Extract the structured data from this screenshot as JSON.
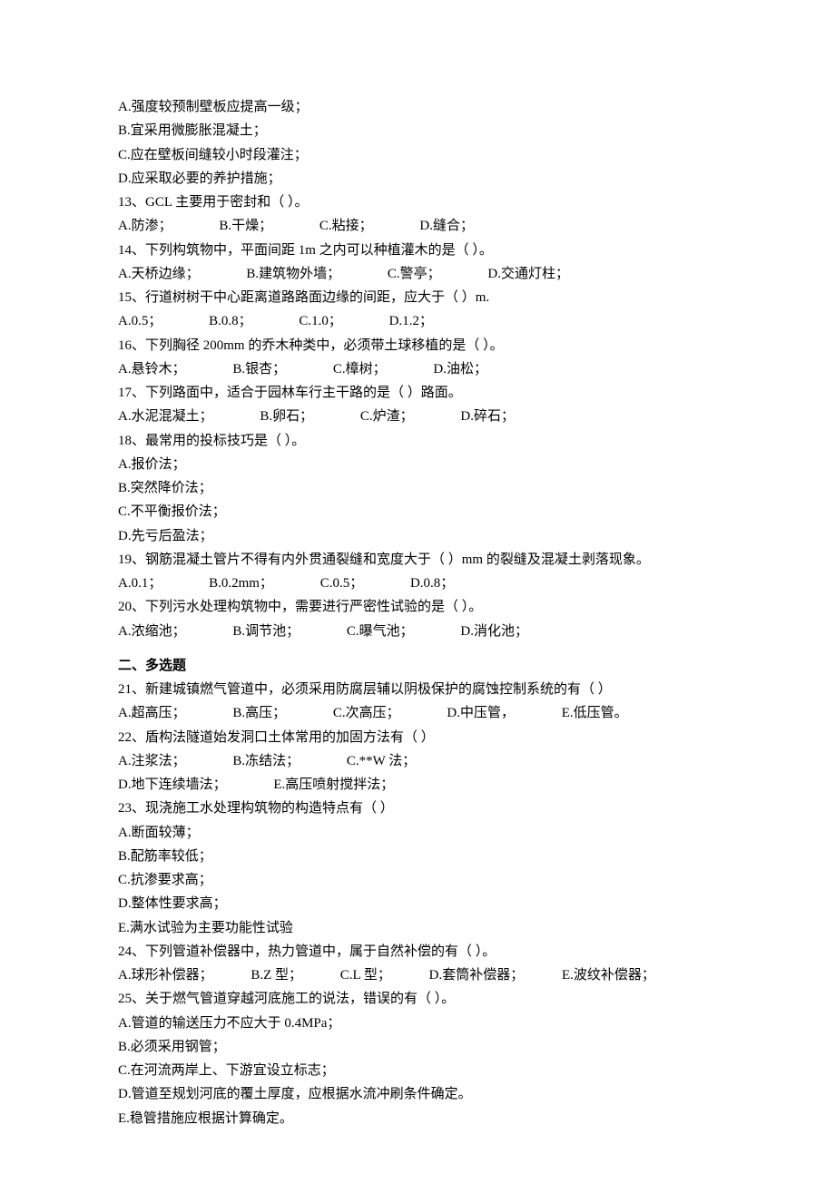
{
  "section1": {
    "orphan_options": [
      "A.强度较预制壁板应提高一级；",
      "B.宜采用微膨胀混凝土；",
      "C.应在壁板间缝较小时段灌注；",
      "D.应采取必要的养护措施；"
    ],
    "questions": [
      {
        "stem": "13、GCL 主要用于密封和（ ）。",
        "opts": [
          "A.防渗；",
          "B.干燥；",
          "C.粘接；",
          "D.缝合；"
        ]
      },
      {
        "stem": "14、下列构筑物中，平面间距 1m 之内可以种植灌木的是（ ）。",
        "opts": [
          "A.天桥边缘；",
          "B.建筑物外墙；",
          "C.警亭；",
          "D.交通灯柱；"
        ]
      },
      {
        "stem": "15、行道树树干中心距离道路路面边缘的间距，应大于（ ）m.",
        "opts": [
          "A.0.5；",
          "B.0.8；",
          "C.1.0；",
          "D.1.2；"
        ]
      },
      {
        "stem": "16、下列胸径 200mm 的乔木种类中，必须带土球移植的是（ ）。",
        "opts": [
          "A.悬铃木；",
          "B.银杏；",
          "C.樟树；",
          "D.油松；"
        ]
      },
      {
        "stem": "17、下列路面中，适合于园林车行主干路的是（ ）路面。",
        "opts": [
          "A.水泥混凝土；",
          "B.卵石；",
          "C.炉渣；",
          "D.碎石；"
        ]
      },
      {
        "stem": "18、最常用的投标技巧是（ ）。",
        "opts_block": [
          "A.报价法；",
          "B.突然降价法；",
          "C.不平衡报价法；",
          "D.先亏后盈法；"
        ]
      },
      {
        "stem": "19、钢筋混凝土管片不得有内外贯通裂缝和宽度大于（ ）mm 的裂缝及混凝土剥落现象。",
        "opts": [
          "A.0.1；",
          "B.0.2mm；",
          "C.0.5；",
          "D.0.8；"
        ]
      },
      {
        "stem": "20、下列污水处理构筑物中，需要进行严密性试验的是（ ）。",
        "opts": [
          "A.浓缩池；",
          "B.调节池；",
          "C.曝气池；",
          "D.消化池；"
        ]
      }
    ]
  },
  "section2": {
    "heading": "二、多选题",
    "questions": [
      {
        "stem": "21、新建城镇燃气管道中，必须采用防腐层辅以阴极保护的腐蚀控制系统的有（ ）",
        "opts": [
          "A.超高压；",
          "B.高压；",
          "C.次高压；",
          "D.中压管，",
          "E.低压管。"
        ]
      },
      {
        "stem": "22、盾构法隧道始发洞口土体常用的加固方法有（ ）",
        "opts_line1": [
          "A.注浆法；",
          "B.冻结法；",
          "C.**W 法；"
        ],
        "opts_line2": [
          "D.地下连续墙法；",
          "E.高压喷射搅拌法；"
        ]
      },
      {
        "stem": "23、现浇施工水处理构筑物的构造特点有（ ）",
        "opts_block": [
          "A.断面较薄；",
          "B.配筋率较低；",
          "C.抗渗要求高；",
          "D.整体性要求高；",
          "E.满水试验为主要功能性试验"
        ]
      },
      {
        "stem": "24、下列管道补偿器中，热力管道中，属于自然补偿的有（ ）。",
        "opts": [
          "A.球形补偿器；",
          "B.Z 型；",
          "C.L 型；",
          "D.套筒补偿器；",
          "E.波纹补偿器；"
        ]
      },
      {
        "stem": "25、关于燃气管道穿越河底施工的说法，错误的有（ ）。",
        "opts_block": [
          "A.管道的输送压力不应大于 0.4MPa；",
          "B.必须采用钢管；",
          "C.在河流两岸上、下游宜设立标志；",
          "D.管道至规划河底的覆土厚度，应根据水流冲刷条件确定。",
          "E.稳管措施应根据计算确定。"
        ]
      }
    ]
  }
}
